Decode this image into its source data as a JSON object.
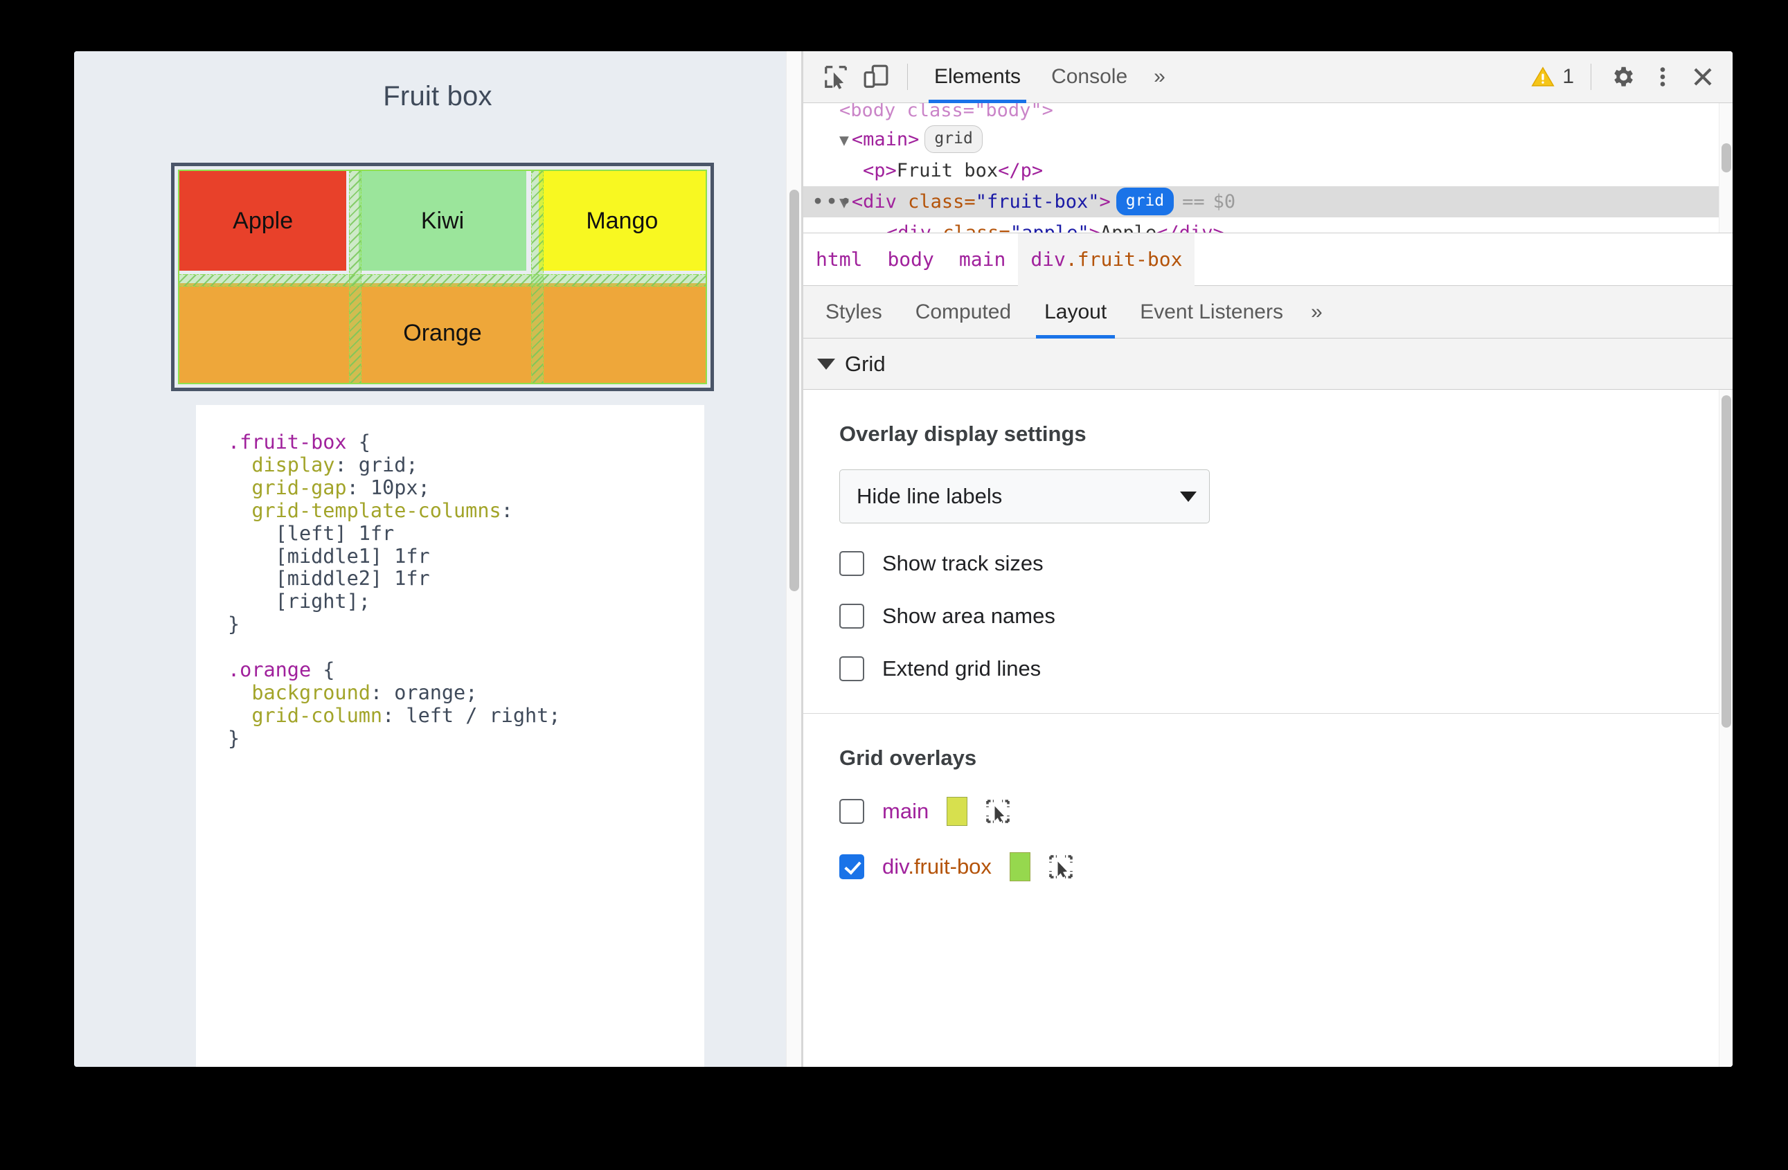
{
  "page": {
    "title": "Fruit box",
    "background_color": "#e9edf2",
    "fruit_cells": [
      {
        "label": "Apple",
        "class": "apple",
        "color": "#e8412a"
      },
      {
        "label": "Kiwi",
        "class": "kiwi",
        "color": "#9be59b"
      },
      {
        "label": "Mango",
        "class": "mango",
        "color": "#f8f821"
      },
      {
        "label": "Orange",
        "class": "orange",
        "color": "#eea73a"
      }
    ],
    "css_source": ".fruit-box {\n  display: grid;\n  grid-gap: 10px;\n  grid-template-columns:\n    [left] 1fr\n    [middle1] 1fr\n    [middle2] 1fr\n    [right];\n}\n\n.orange {\n  background: orange;\n  grid-column: left / right;\n}"
  },
  "devtools": {
    "toolbar": {
      "inspect_icon": "inspect-cursor-icon",
      "device_toggle_icon": "device-toolbar-icon",
      "tabs": [
        {
          "label": "Elements",
          "active": true
        },
        {
          "label": "Console",
          "active": false
        }
      ],
      "more_tabs_label": "»",
      "warning_count": "1",
      "warning_icon": "warning-triangle-icon",
      "settings_icon": "gear-icon",
      "more_options_icon": "kebab-menu-icon",
      "close_icon": "close-icon"
    },
    "dom_tree": {
      "rows": [
        {
          "kind": "cut",
          "text": "<body class=\"body\">"
        },
        {
          "kind": "element",
          "indent": 0,
          "twisty": "▼",
          "open": "<main>",
          "badge": "grid",
          "badge_active": false
        },
        {
          "kind": "text",
          "indent": 1,
          "open": "<p>",
          "text": "Fruit box",
          "close": "</p>"
        },
        {
          "kind": "selected",
          "indent": 0,
          "twisty": "▼",
          "tag_open": "<div ",
          "attr_name": "class=",
          "attr_value": "\"fruit-box\"",
          "tag_close": ">",
          "badge": "grid",
          "badge_active": true,
          "equals": "==",
          "console_ref": "$0",
          "ellipsis": "•••"
        },
        {
          "kind": "child",
          "indent": 1,
          "tag_open": "<div ",
          "attr_name": "class=",
          "attr_value": "\"apple\"",
          "tag_close": ">",
          "text": "Apple",
          "close": "</div>"
        }
      ]
    },
    "breadcrumb": [
      {
        "label": "html",
        "active": false
      },
      {
        "label": "body",
        "active": false
      },
      {
        "label": "main",
        "active": false
      },
      {
        "label": "div",
        "cls": ".fruit-box",
        "active": true
      }
    ],
    "panel_tabs": [
      {
        "label": "Styles",
        "active": false
      },
      {
        "label": "Computed",
        "active": false
      },
      {
        "label": "Layout",
        "active": true
      },
      {
        "label": "Event Listeners",
        "active": false
      }
    ],
    "panel_tabs_overflow": "»",
    "layout": {
      "grid_section_title": "Grid",
      "overlay_settings_title": "Overlay display settings",
      "line_labels_select": {
        "value": "Hide line labels"
      },
      "checkboxes": [
        {
          "label": "Show track sizes",
          "checked": false
        },
        {
          "label": "Show area names",
          "checked": false
        },
        {
          "label": "Extend grid lines",
          "checked": false
        }
      ],
      "grid_overlays_title": "Grid overlays",
      "overlays": [
        {
          "name": "main",
          "cls": "",
          "checked": false,
          "color": "#d7e04e"
        },
        {
          "name": "div",
          "cls": ".fruit-box",
          "checked": true,
          "color": "#96d84e"
        }
      ]
    }
  }
}
